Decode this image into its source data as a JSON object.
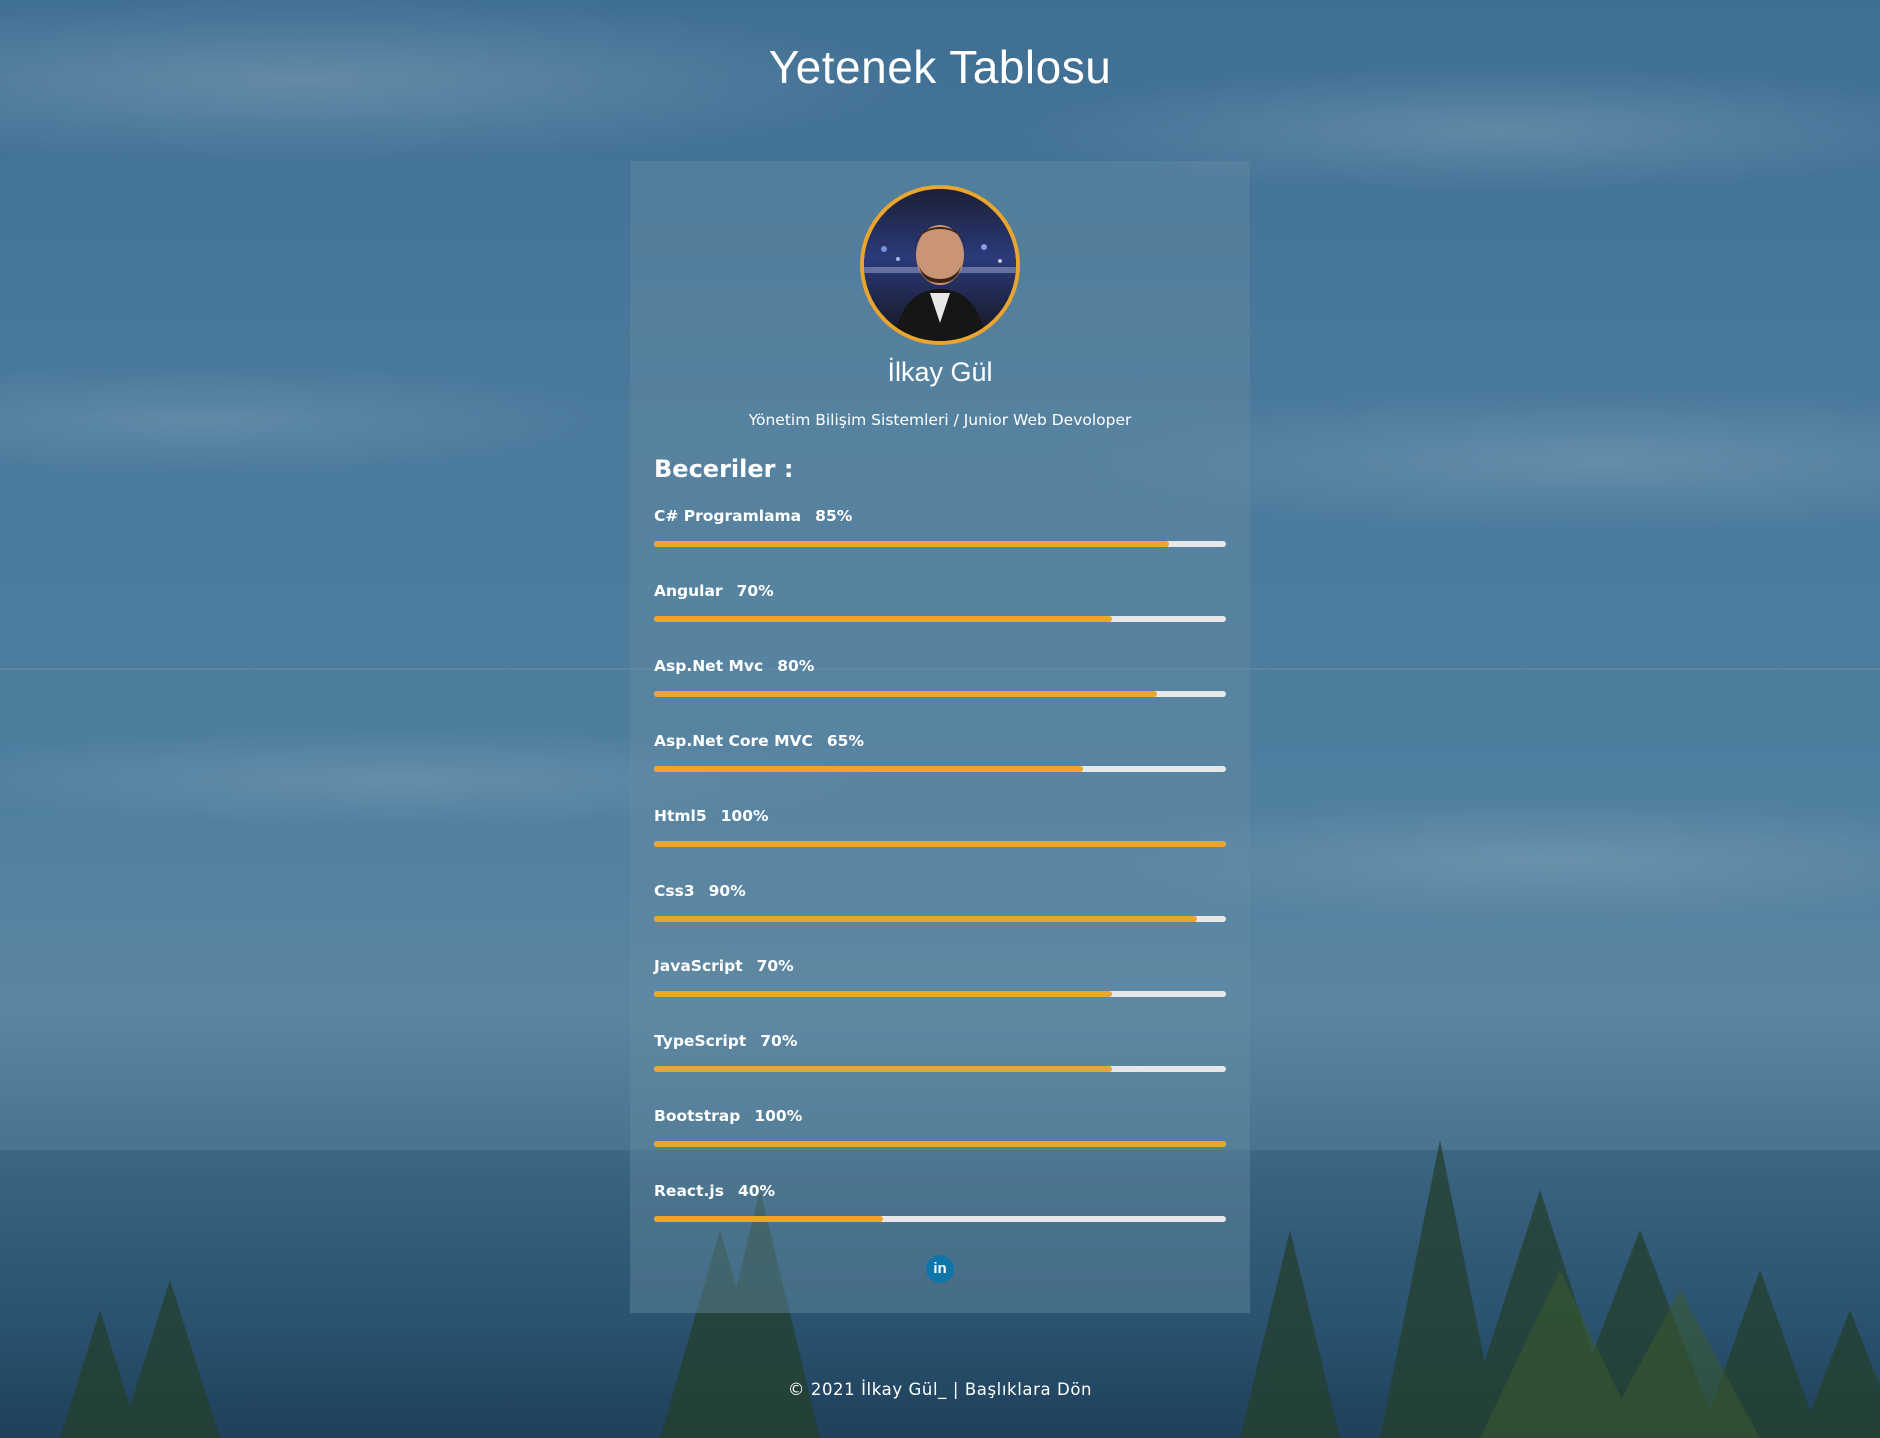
{
  "page": {
    "title": "Yetenek Tablosu"
  },
  "profile": {
    "name": "İlkay Gül",
    "role": "Yönetim Bilişim Sistemleri / Junior Web Devoloper",
    "avatar_alt": "profile-photo"
  },
  "skills": {
    "heading": "Beceriler :",
    "items": [
      {
        "label": "C# Programlama",
        "percent_text": "85%",
        "value": 0.9
      },
      {
        "label": "Angular",
        "percent_text": "70%",
        "value": 0.8
      },
      {
        "label": "Asp.Net Mvc",
        "percent_text": "80%",
        "value": 0.88
      },
      {
        "label": "Asp.Net Core MVC",
        "percent_text": "65%",
        "value": 0.75
      },
      {
        "label": "Html5",
        "percent_text": "100%",
        "value": 1.0
      },
      {
        "label": "Css3",
        "percent_text": "90%",
        "value": 0.95
      },
      {
        "label": "JavaScript",
        "percent_text": "70%",
        "value": 0.8
      },
      {
        "label": "TypeScript",
        "percent_text": "70%",
        "value": 0.8
      },
      {
        "label": "Bootstrap",
        "percent_text": "100%",
        "value": 1.0
      },
      {
        "label": "React.js",
        "percent_text": "40%",
        "value": 0.4
      }
    ]
  },
  "social": {
    "linkedin_label": "in",
    "linkedin_icon": "linkedin-icon"
  },
  "footer": {
    "text": "© 2021 İlkay Gül_ | Başlıklara Dön"
  },
  "colors": {
    "accent": "#e9a52e",
    "track": "#e6e8ea",
    "linkedin": "#0e76a8"
  }
}
